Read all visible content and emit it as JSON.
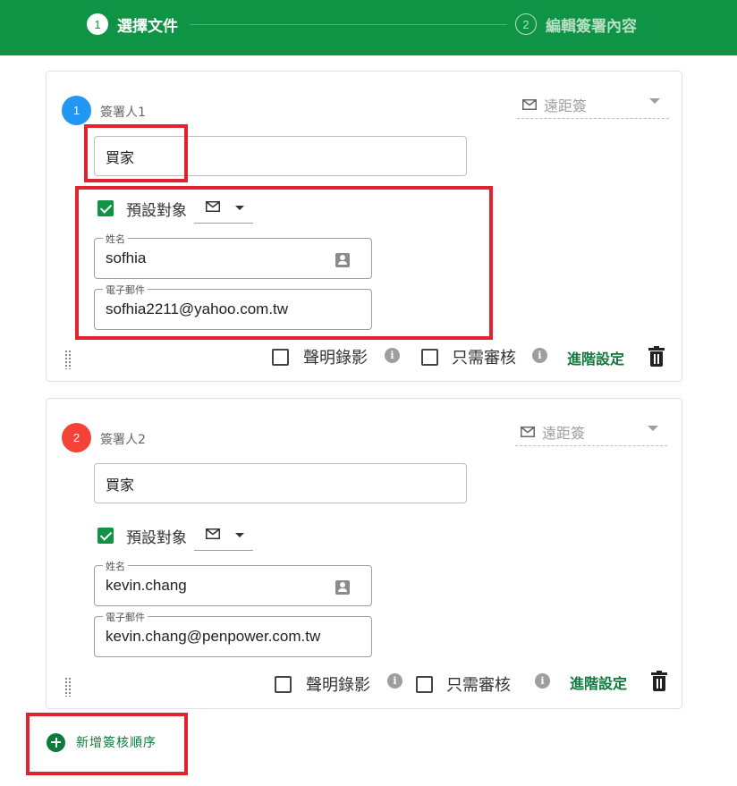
{
  "stepper": {
    "steps": [
      {
        "num": "1",
        "label": "選擇文件",
        "active": true
      },
      {
        "num": "2",
        "label": "編輯簽署內容",
        "active": false
      }
    ]
  },
  "signers": [
    {
      "badge": "1",
      "badge_color": "#2196f3",
      "label": "簽署人1",
      "method_icon": "mail-icon",
      "method": "遠距簽",
      "role": "買家",
      "default_target_label": "預設對象",
      "default_target_checked": true,
      "contact_icon": "mail-icon",
      "name_legend": "姓名",
      "name": "sofhia",
      "email_legend": "電子郵件",
      "email": "sofhia2211@yahoo.com.tw",
      "record_label": "聲明錄影",
      "review_label": "只需審核",
      "advanced_label": "進階設定"
    },
    {
      "badge": "2",
      "badge_color": "#f44336",
      "label": "簽署人2",
      "method_icon": "mail-icon",
      "method": "遠距簽",
      "role": "買家",
      "default_target_label": "預設對象",
      "default_target_checked": true,
      "contact_icon": "mail-icon",
      "name_legend": "姓名",
      "name": "kevin.chang",
      "email_legend": "電子郵件",
      "email": "kevin.chang@penpower.com.tw",
      "record_label": "聲明錄影",
      "review_label": "只需審核",
      "advanced_label": "進階設定"
    }
  ],
  "add_order": {
    "label": "新增簽核順序"
  },
  "colors": {
    "brand_green": "#0e9444",
    "link_green": "#0e7a3c",
    "annotation_red": "#e0232f"
  }
}
